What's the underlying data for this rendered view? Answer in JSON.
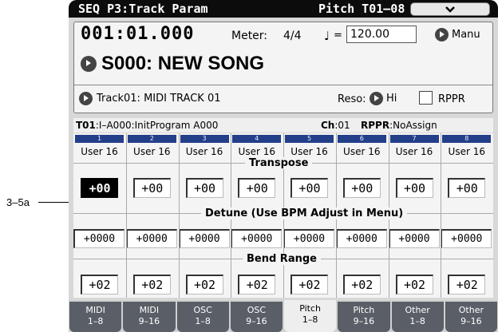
{
  "callout": {
    "label": "3–5a"
  },
  "title": {
    "left": "SEQ P3:Track Param",
    "right": "Pitch T01–08",
    "menu_icon": "chevron-down-icon"
  },
  "location": "001:01.000",
  "meter": {
    "label": "Meter:",
    "value": "4/4"
  },
  "tempo": {
    "note_glyph": "♩",
    "eq": "=",
    "value": "120.00",
    "mode": "Manu"
  },
  "song": {
    "name": "S000: NEW SONG"
  },
  "track": {
    "name": "Track01: MIDI TRACK 01"
  },
  "reso": {
    "label": "Reso:",
    "value": "Hi"
  },
  "rppr": {
    "label": "RPPR",
    "checked": false
  },
  "track_info": {
    "track": "T01",
    "program": ":I–A000:InitProgram A000",
    "ch_label": "Ch",
    "ch_value": ":01",
    "rppr_label": "RPPR",
    "rppr_value": ":NoAssign"
  },
  "sections": {
    "transpose": "Transpose",
    "detune": "Detune (Use BPM Adjust in Menu)",
    "bend": "Bend Range"
  },
  "columns": [
    {
      "num": "1",
      "program": "User 16",
      "transpose": "+00",
      "detune": "+0000",
      "bend": "+02"
    },
    {
      "num": "2",
      "program": "User 16",
      "transpose": "+00",
      "detune": "+0000",
      "bend": "+02"
    },
    {
      "num": "3",
      "program": "User 16",
      "transpose": "+00",
      "detune": "+0000",
      "bend": "+02"
    },
    {
      "num": "4",
      "program": "User 16",
      "transpose": "+00",
      "detune": "+0000",
      "bend": "+02"
    },
    {
      "num": "5",
      "program": "User 16",
      "transpose": "+00",
      "detune": "+0000",
      "bend": "+02"
    },
    {
      "num": "6",
      "program": "User 16",
      "transpose": "+00",
      "detune": "+0000",
      "bend": "+02"
    },
    {
      "num": "7",
      "program": "User 16",
      "transpose": "+00",
      "detune": "+0000",
      "bend": "+02"
    },
    {
      "num": "8",
      "program": "User 16",
      "transpose": "+00",
      "detune": "+0000",
      "bend": "+02"
    }
  ],
  "tabs": [
    {
      "line1": "MIDI",
      "line2": "1–8"
    },
    {
      "line1": "MIDI",
      "line2": "9–16"
    },
    {
      "line1": "OSC",
      "line2": "1–8"
    },
    {
      "line1": "OSC",
      "line2": "9–16"
    },
    {
      "line1": "Pitch",
      "line2": "1–8",
      "active": true
    },
    {
      "line1": "Pitch",
      "line2": "9–16"
    },
    {
      "line1": "Other",
      "line2": "1–8"
    },
    {
      "line1": "Other",
      "line2": "9–16"
    }
  ]
}
